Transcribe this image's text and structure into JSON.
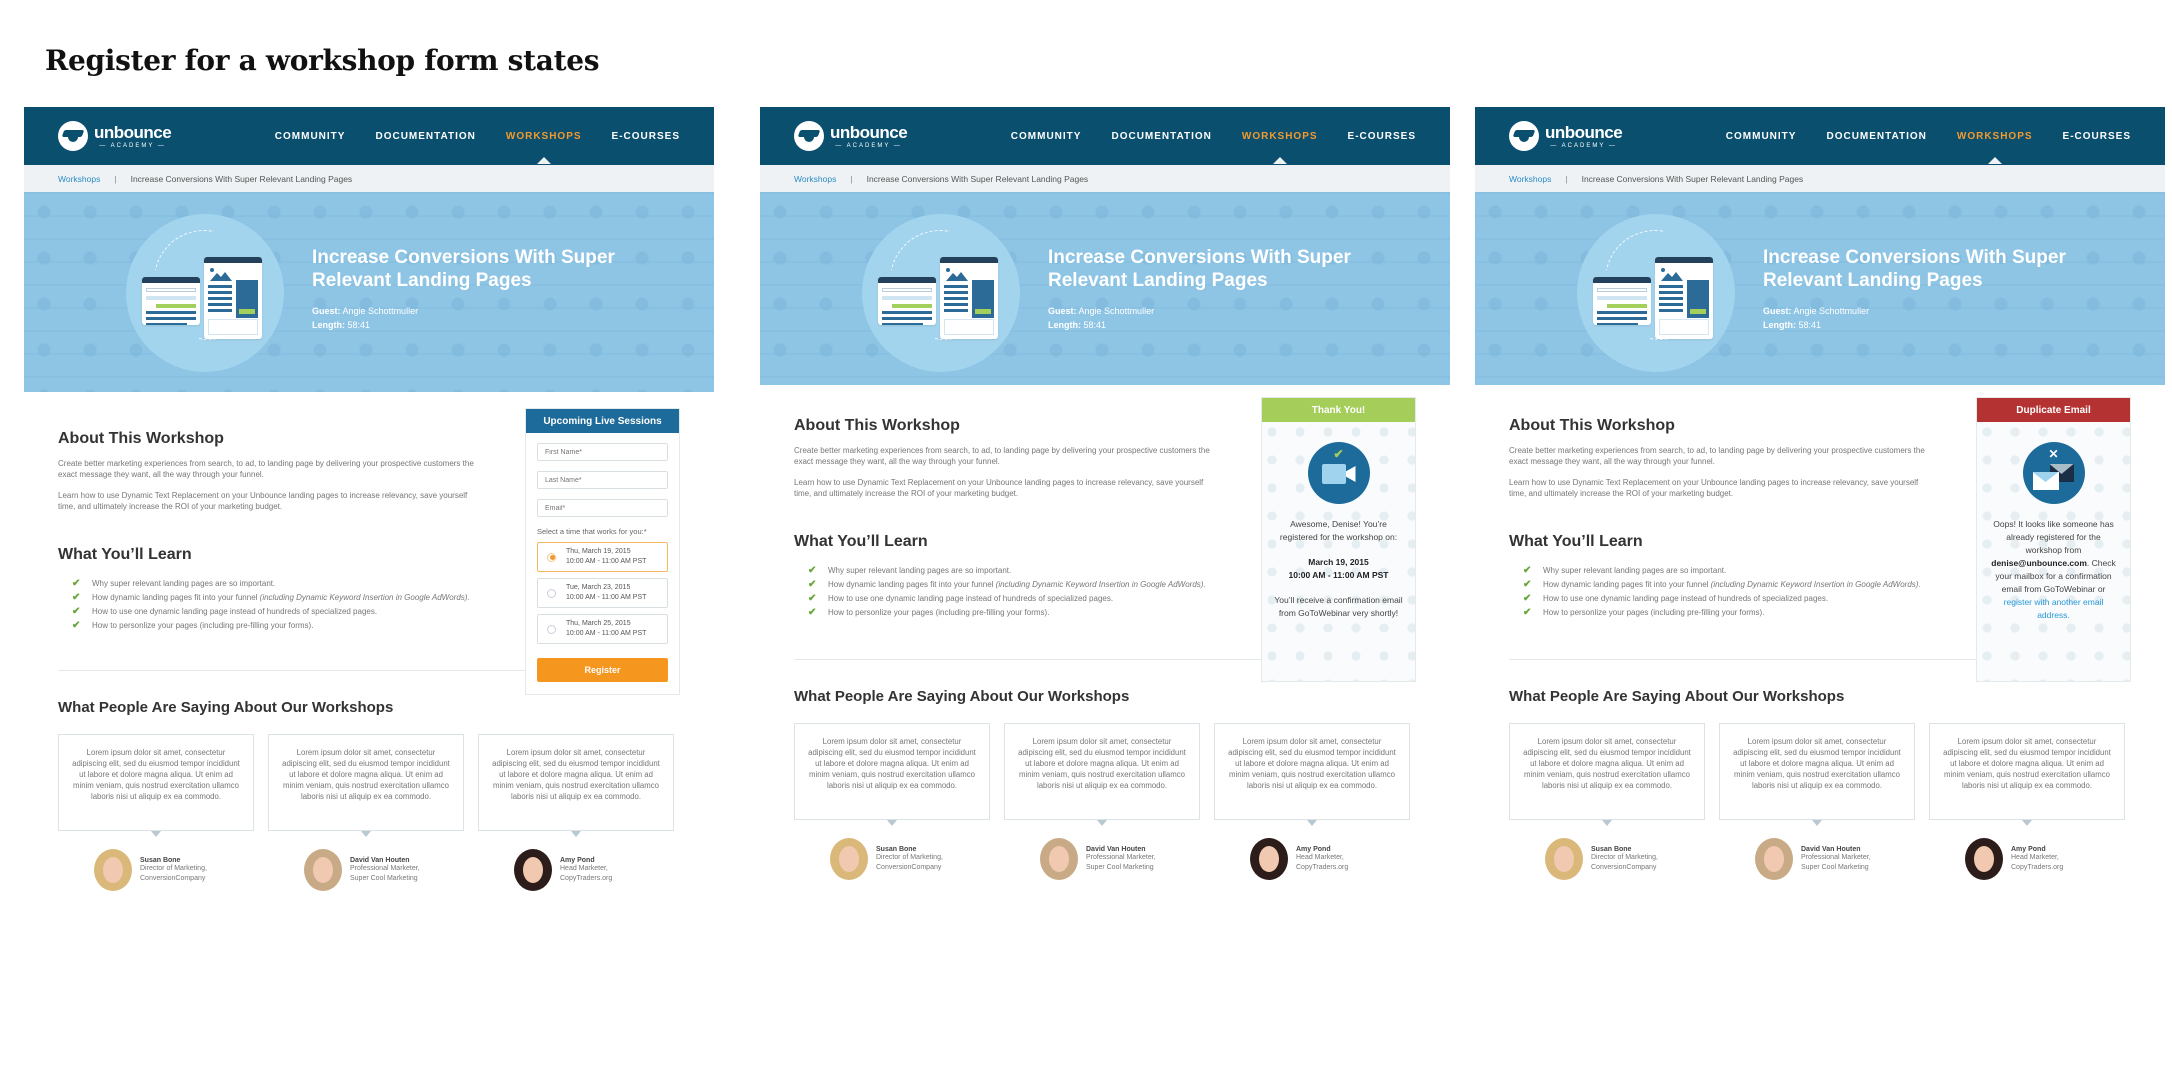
{
  "page_title": "Register for a workshop form states",
  "nav": {
    "brand": "unbounce",
    "brand_sub": "ACADEMY",
    "items": [
      "COMMUNITY",
      "DOCUMENTATION",
      "WORKSHOPS",
      "E-COURSES"
    ],
    "active": "WORKSHOPS"
  },
  "breadcrumb": {
    "link": "Workshops",
    "separator": "|",
    "current": "Increase Conversions With Super Relevant Landing Pages"
  },
  "hero": {
    "title": "Increase Conversions With Super Relevant Landing Pages",
    "guest_label": "Guest:",
    "guest": "Angie Schottmuller",
    "length_label": "Length:",
    "length": "58:41"
  },
  "about": {
    "heading": "About This Workshop",
    "paragraphs": [
      "Create better marketing experiences from search, to ad, to landing page by delivering your prospective customers the exact message they want, all the way through your funnel.",
      "Learn how to use Dynamic Text Replacement on your Unbounce landing pages to increase relevancy, save yourself time, and ultimately increase the ROI of your marketing budget."
    ]
  },
  "learn": {
    "heading": "What You’ll Learn",
    "items": [
      {
        "text": "Why super relevant landing pages are so important.",
        "italic": ""
      },
      {
        "text": "How dynamic landing pages fit into your funnel ",
        "italic": "(including Dynamic Keyword Insertion in Google AdWords)."
      },
      {
        "text": "How to use one dynamic landing page instead of hundreds of specialized pages.",
        "italic": ""
      },
      {
        "text": "How to personlize your pages (including pre-filling your forms).",
        "italic": ""
      }
    ]
  },
  "form": {
    "heading": "Upcoming Live Sessions",
    "first_name_placeholder": "First Name*",
    "last_name_placeholder": "Last Name*",
    "email_placeholder": "Email*",
    "select_label": "Select a time that works for you:*",
    "sessions": [
      {
        "date": "Thu, March 19, 2015",
        "time": "10:00 AM - 11:00 AM PST",
        "selected": true
      },
      {
        "date": "Tue, March 23, 2015",
        "time": "10:00 AM - 11:00 AM PST",
        "selected": false
      },
      {
        "date": "Thu, March 25, 2015",
        "time": "10:00 AM - 11:00 AM PST",
        "selected": false
      }
    ],
    "submit_label": "Register"
  },
  "thank_you": {
    "heading": "Thank You!",
    "line1": "Awesome, Denise! You’re registered for the workshop on:",
    "date": "March 19, 2015",
    "time": "10:00 AM - 11:00 AM PST",
    "line2": "You’ll receive a confirmation email from GoToWebinar very shortly!",
    "accent": "#a4cd5a"
  },
  "duplicate": {
    "heading": "Duplicate Email",
    "text_before": "Oops! It looks like someone has already registered for the workshop from ",
    "email": "denise@unbounce.com",
    "text_after": ". Check your mailbox for a confirmation email from GoToWebinar or ",
    "link": "register with another email address.",
    "accent": "#b53232"
  },
  "testimonials": {
    "heading": "What People Are Saying About Our Workshops",
    "items": [
      {
        "quote": "Lorem ipsum dolor sit amet, consectetur adipiscing elit, sed du eiusmod tempor incididunt ut labore et dolore magna aliqua. Ut enim ad minim veniam, quis nostrud exercitation ullamco laboris nisi ut aliquip ex ea commodo.",
        "name": "Susan Bone",
        "role": "Director of Marketing,",
        "company": "ConversionCompany"
      },
      {
        "quote": "Lorem ipsum dolor sit amet, consectetur adipiscing elit, sed du eiusmod tempor incididunt ut labore et dolore magna aliqua. Ut enim ad minim veniam, quis nostrud exercitation ullamco laboris nisi ut aliquip ex ea commodo.",
        "name": "David Van Houten",
        "role": "Professional Marketer,",
        "company": "Super Cool Marketing"
      },
      {
        "quote": "Lorem ipsum dolor sit amet, consectetur adipiscing elit, sed du eiusmod tempor incididunt ut labore et dolore magna aliqua. Ut enim ad minim veniam, quis nostrud exercitation ullamco laboris nisi ut aliquip ex ea commodo.",
        "name": "Amy Pond",
        "role": "Head Marketer,",
        "company": "CopyTraders.org"
      }
    ]
  },
  "colors": {
    "nav_bg": "#0b4f6e",
    "active_nav": "#f29a2e",
    "hero_bg": "#8ec4e4",
    "form_header": "#1d6b9b",
    "register_button": "#f5961f",
    "link": "#2a9ad8"
  }
}
